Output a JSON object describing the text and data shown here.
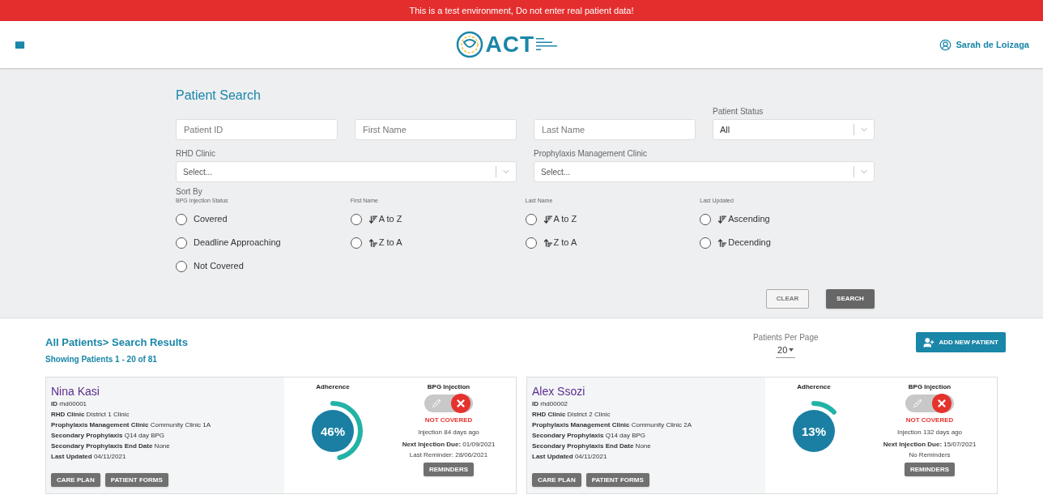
{
  "banner": {
    "text": "This is a test environment, Do not enter real patient data!"
  },
  "header": {
    "logo_text": "ACT",
    "user": "Sarah de Loizaga"
  },
  "search": {
    "title": "Patient Search",
    "text_fields": [
      {
        "placeholder": "Patient ID"
      },
      {
        "placeholder": "First Name"
      },
      {
        "placeholder": "Last Name"
      }
    ],
    "patient_status": {
      "label": "Patient Status",
      "value": "All"
    },
    "clinic_selects": [
      {
        "label": "RHD Clinic",
        "placeholder": "Select..."
      },
      {
        "label": "Prophylaxis Management Clinic",
        "placeholder": "Select..."
      }
    ],
    "sort_by": {
      "label": "Sort By",
      "groups": [
        {
          "title": "BPG Injection Status",
          "options": [
            {
              "kind": "plain",
              "label": "Covered",
              "selected": false
            },
            {
              "kind": "plain",
              "label": "Deadline Approaching",
              "selected": false
            },
            {
              "kind": "plain",
              "label": "Not Covered",
              "selected": false
            }
          ]
        },
        {
          "title": "First Name",
          "options": [
            {
              "kind": "ascending",
              "label": "A to Z",
              "selected": false
            },
            {
              "kind": "descending",
              "label": "Z to A",
              "selected": false
            }
          ]
        },
        {
          "title": "Last Name",
          "options": [
            {
              "kind": "ascending",
              "label": "A to Z",
              "selected": false
            },
            {
              "kind": "descending",
              "label": "Z to A",
              "selected": false
            }
          ]
        },
        {
          "title": "Last Updated",
          "options": [
            {
              "kind": "ascending",
              "label": "Ascending",
              "selected": false
            },
            {
              "kind": "descending",
              "label": "Decending",
              "selected": false
            }
          ]
        }
      ]
    },
    "buttons": {
      "clear": "CLEAR",
      "search": "SEARCH"
    }
  },
  "results": {
    "title": "All Patients> Search Results",
    "showing": "Showing Patients 1 - 20 of 81",
    "per_page_label": "Patients Per Page",
    "per_page": "20",
    "add_button": "ADD NEW PATIENT",
    "patients": [
      {
        "name": "Nina Kasi",
        "fields": [
          {
            "label": "ID",
            "value": "rhd00001"
          },
          {
            "label": "RHD Clinic",
            "value": "District 1 Clinic"
          },
          {
            "label": "Prophylaxis Management Clinic",
            "value": "Community Clinic 1A"
          },
          {
            "label": "Secondary Prophylaxis",
            "value": "Q14 day BPG"
          },
          {
            "label": "Secondary Prophylaxis End Date",
            "value": "None"
          },
          {
            "label": "Last Updated",
            "value": "04/11/2021"
          }
        ],
        "buttons": [
          "CARE PLAN",
          "PATIENT FORMS"
        ],
        "adherence_label": "Adherence",
        "adherence": {
          "level": 0.46,
          "text": "46%"
        },
        "injection_label": "BPG Injection",
        "covered": false,
        "status": "NOT COVERED",
        "injection_ago": "Injection 84 days ago",
        "next_due_label": "Next Injection Due:",
        "next_due": "01/09/2021",
        "reminder": "Last Reminder: 28/06/2021",
        "reminders_button": "REMINDERS"
      },
      {
        "name": "Alex Ssozi",
        "fields": [
          {
            "label": "ID",
            "value": "rhd00002"
          },
          {
            "label": "RHD Clinic",
            "value": "District 2 Clinic"
          },
          {
            "label": "Prophylaxis Management Clinic",
            "value": "Community Clinic 2A"
          },
          {
            "label": "Secondary Prophylaxis",
            "value": "Q14 day BPG"
          },
          {
            "label": "Secondary Prophylaxis End Date",
            "value": "None"
          },
          {
            "label": "Last Updated",
            "value": "04/11/2021"
          }
        ],
        "buttons": [
          "CARE PLAN",
          "PATIENT FORMS"
        ],
        "adherence_label": "Adherence",
        "adherence": {
          "level": 0.13,
          "text": "13%"
        },
        "injection_label": "BPG Injection",
        "covered": false,
        "status": "NOT COVERED",
        "injection_ago": "Injection 132 days ago",
        "next_due_label": "Next Injection Due:",
        "next_due": "15/07/2021",
        "reminder": "No Reminders",
        "reminders_button": "REMINDERS"
      }
    ]
  }
}
